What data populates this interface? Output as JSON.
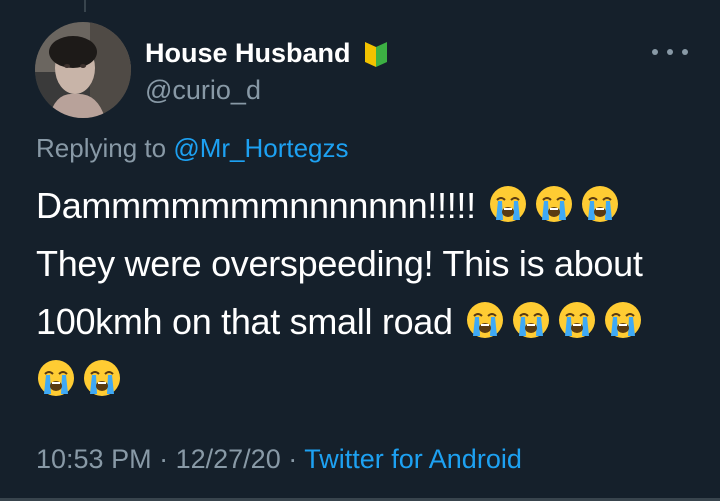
{
  "user": {
    "display_name": "House Husband",
    "badge_icon": "beginner-mark-icon",
    "handle": "@curio_d"
  },
  "reply": {
    "prefix": "Replying to",
    "mention": "@Mr_Hortegzs"
  },
  "tweet": {
    "line1": "Dammmmmmmnnnnnnn!!!!!",
    "line2": "They were overspeeding! This is about",
    "line3": "100kmh on that small road",
    "emoji_icon": "loudly-crying-face-icon"
  },
  "meta": {
    "time": "10:53 PM",
    "separator": "·",
    "date": "12/27/20",
    "source": "Twitter for Android"
  },
  "colors": {
    "background": "#15202b",
    "text": "#ffffff",
    "secondary": "#8899a6",
    "accent": "#1da1f2"
  }
}
